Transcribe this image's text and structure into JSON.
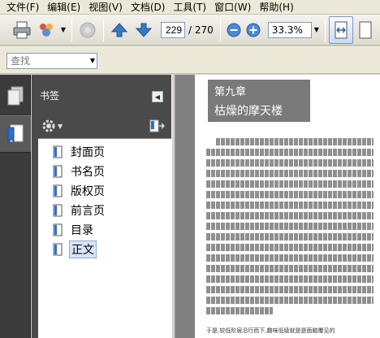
{
  "menubar": {
    "items": [
      {
        "label": "文件(F)"
      },
      {
        "label": "编辑(E)"
      },
      {
        "label": "视图(V)"
      },
      {
        "label": "文档(D)"
      },
      {
        "label": "工具(T)"
      },
      {
        "label": "窗口(W)"
      },
      {
        "label": "帮助(H)"
      }
    ]
  },
  "toolbar": {
    "current_page": "229",
    "total_pages": "/ 270",
    "zoom": "33.3%",
    "icons": [
      "print-icon",
      "collaborate-icon",
      "secure-icon",
      "previous-page-icon",
      "next-page-icon",
      "zoom-out-icon",
      "zoom-in-icon",
      "fit-width-icon"
    ]
  },
  "findbar": {
    "placeholder": "查找"
  },
  "bookmarks": {
    "title": "书签",
    "items": [
      {
        "label": "封面页"
      },
      {
        "label": "书名页"
      },
      {
        "label": "版权页"
      },
      {
        "label": "前言页"
      },
      {
        "label": "目录"
      },
      {
        "label": "正文"
      }
    ],
    "selected_index": 5
  },
  "document": {
    "chapter_number": "第九章",
    "chapter_title": "枯燥的摩天楼",
    "last_line": "于是,较低阶层沿行而下,趣味低级就是是面脑覆见的"
  }
}
